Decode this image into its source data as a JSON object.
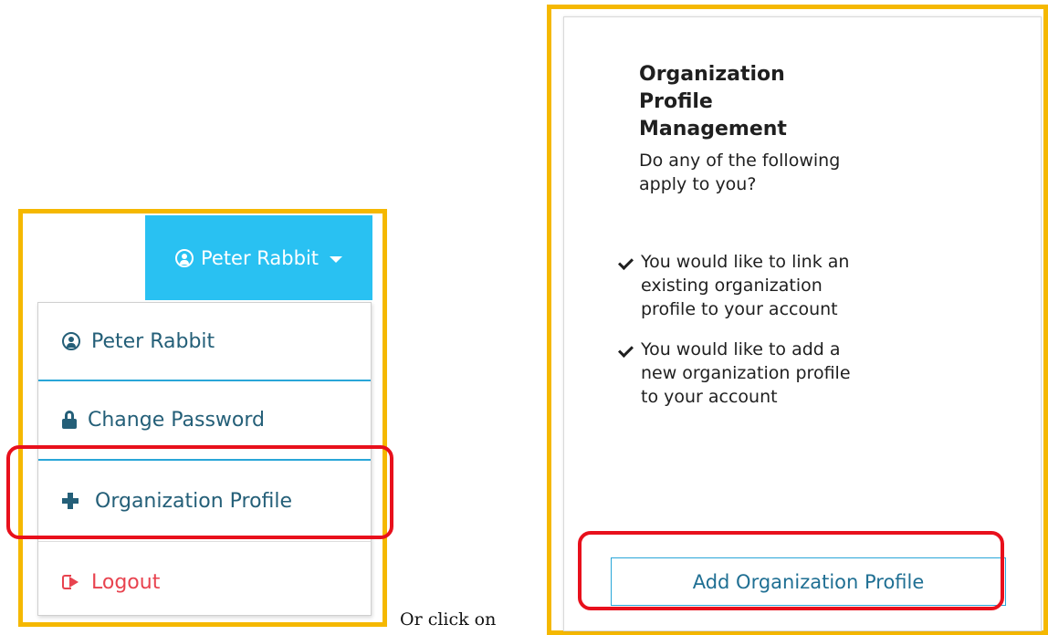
{
  "user_menu": {
    "button_label": "Peter Rabbit",
    "items": [
      {
        "label": "Peter Rabbit",
        "icon": "user-circle-icon"
      },
      {
        "label": "Change Password",
        "icon": "lock-icon"
      },
      {
        "label": "Organization Profile",
        "icon": "plus-icon"
      },
      {
        "label": "Logout",
        "icon": "sign-out-icon"
      }
    ]
  },
  "caption": "Or click on",
  "card": {
    "title": "Organization Profile Management",
    "intro": "Do any of the following apply to you?",
    "bullets": [
      "You would like to link an existing organization profile to your account",
      "You would like to add a new organization profile to your account"
    ],
    "button_label": "Add Organization Profile"
  },
  "colors": {
    "highlight_frame": "#f5b800",
    "callout_box": "#e8101c",
    "user_button_bg": "#29c1f2",
    "menu_text": "#245f78",
    "logout_text": "#e8434f"
  }
}
